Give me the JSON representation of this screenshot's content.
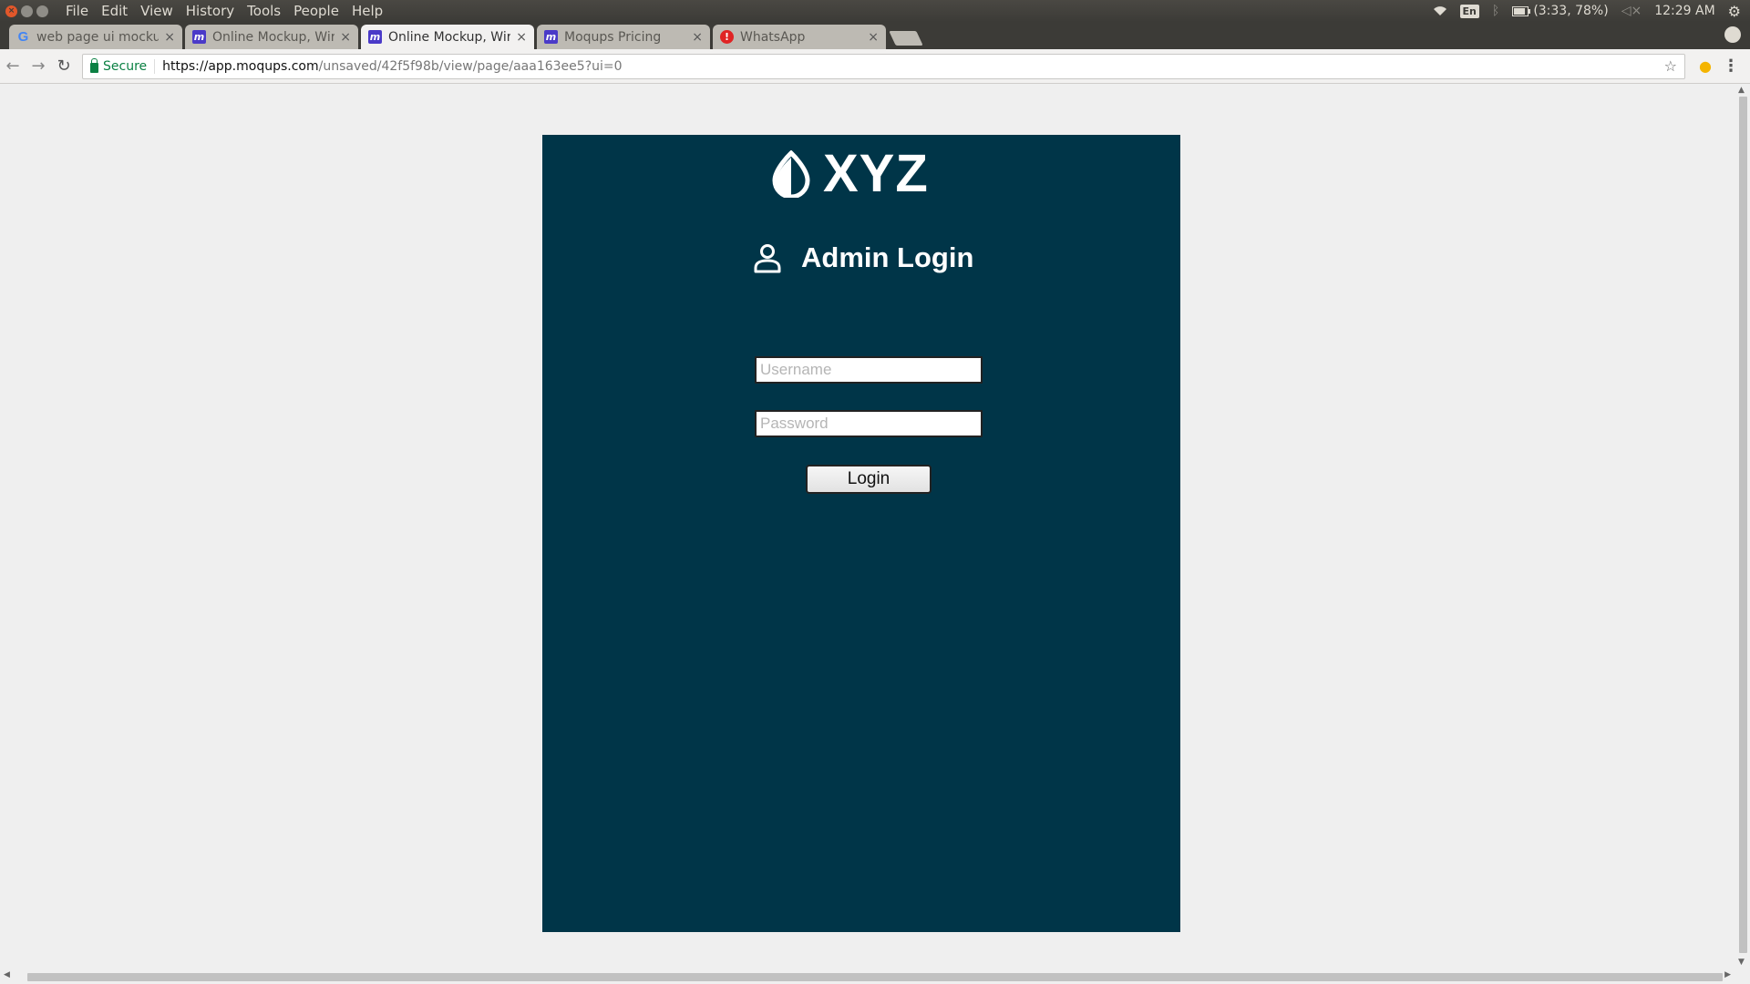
{
  "system": {
    "menu": [
      "File",
      "Edit",
      "View",
      "History",
      "Tools",
      "People",
      "Help"
    ],
    "tray": {
      "lang": "En",
      "battery": "(3:33, 78%)",
      "clock": "12:29 AM"
    }
  },
  "tabs": [
    {
      "title": "web page ui mockup",
      "favicon": "google-icon"
    },
    {
      "title": "Online Mockup, Wireframe",
      "favicon": "moqups-icon"
    },
    {
      "title": "Online Mockup, Wireframe",
      "favicon": "moqups-icon",
      "active": true
    },
    {
      "title": "Moqups Pricing",
      "favicon": "moqups-icon"
    },
    {
      "title": "WhatsApp",
      "favicon": "whatsapp-alert-icon"
    }
  ],
  "address": {
    "secure_label": "Secure",
    "url_host": "https://app.moqups.com",
    "url_path": "/unsaved/42f5f98b/view/page/aaa163ee5?ui=0"
  },
  "mockup": {
    "brand": "XYZ",
    "heading": "Admin Login",
    "username_placeholder": "Username",
    "password_placeholder": "Password",
    "login_label": "Login",
    "panel_color": "#003548"
  }
}
